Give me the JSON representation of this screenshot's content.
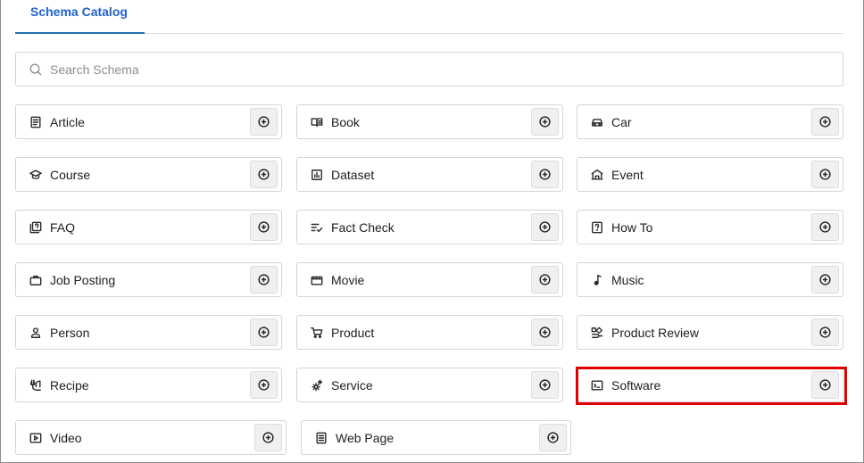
{
  "tabs": [
    {
      "label": "Schema Catalog",
      "active": true
    }
  ],
  "search": {
    "placeholder": "Search Schema",
    "value": ""
  },
  "highlight_color": "#e00000",
  "accent_color": "#2062c9",
  "schemas": [
    {
      "label": "Article",
      "icon": "article-icon"
    },
    {
      "label": "Book",
      "icon": "book-icon"
    },
    {
      "label": "Car",
      "icon": "car-icon"
    },
    {
      "label": "Course",
      "icon": "course-icon"
    },
    {
      "label": "Dataset",
      "icon": "dataset-icon"
    },
    {
      "label": "Event",
      "icon": "event-icon"
    },
    {
      "label": "FAQ",
      "icon": "faq-icon"
    },
    {
      "label": "Fact Check",
      "icon": "fact-check-icon"
    },
    {
      "label": "How To",
      "icon": "how-to-icon"
    },
    {
      "label": "Job Posting",
      "icon": "job-posting-icon"
    },
    {
      "label": "Movie",
      "icon": "movie-icon"
    },
    {
      "label": "Music",
      "icon": "music-icon"
    },
    {
      "label": "Person",
      "icon": "person-icon"
    },
    {
      "label": "Product",
      "icon": "product-icon"
    },
    {
      "label": "Product Review",
      "icon": "product-review-icon"
    },
    {
      "label": "Recipe",
      "icon": "recipe-icon"
    },
    {
      "label": "Service",
      "icon": "service-icon"
    },
    {
      "label": "Software",
      "icon": "software-icon",
      "highlighted": true
    },
    {
      "label": "Video",
      "icon": "video-icon"
    },
    {
      "label": "Web Page",
      "icon": "web-page-icon"
    }
  ]
}
